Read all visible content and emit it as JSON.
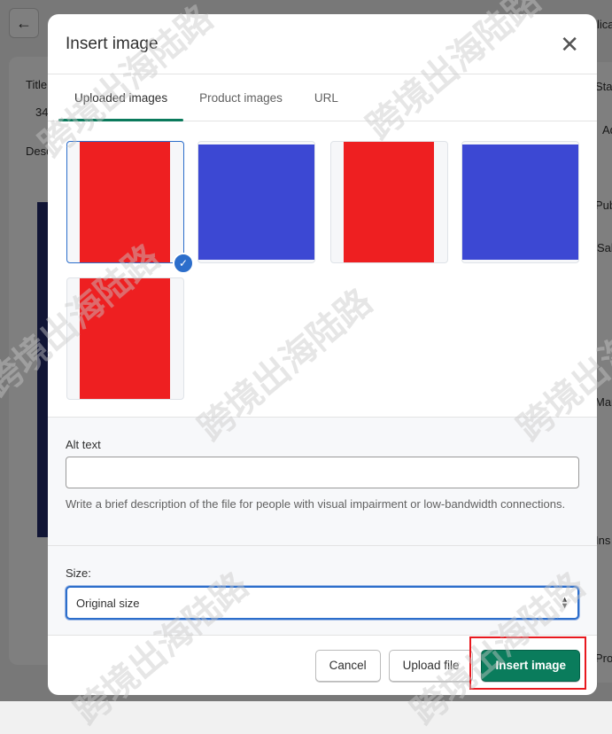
{
  "background": {
    "fragments": [
      "lica",
      "Title",
      "34",
      "Desc",
      "Sta",
      "Ad",
      "Pub",
      "Sale",
      "Mar",
      "Ins",
      "Pro"
    ]
  },
  "modal": {
    "title": "Insert image",
    "tabs": [
      {
        "label": "Uploaded images",
        "selected": true
      },
      {
        "label": "Product images",
        "selected": false
      },
      {
        "label": "URL",
        "selected": false
      }
    ],
    "images": [
      {
        "color": "#ee1f21",
        "selected": true
      },
      {
        "color": "#3c48d3",
        "selected": false
      },
      {
        "color": "#ee1f21",
        "selected": false
      },
      {
        "color": "#3c48d3",
        "selected": false
      },
      {
        "color": "#ee1f21",
        "selected": false
      }
    ],
    "alt_text": {
      "label": "Alt text",
      "value": "",
      "help": "Write a brief description of the file for people with visual impairment or low-bandwidth connections."
    },
    "size": {
      "label": "Size:",
      "value": "Original size"
    },
    "buttons": {
      "cancel": "Cancel",
      "upload": "Upload file",
      "insert": "Insert image"
    }
  },
  "watermark": "跨境出海陆路",
  "colors": {
    "primary": "#0a7c5c",
    "selection": "#2c6ecb",
    "highlight": "#e8191f"
  }
}
